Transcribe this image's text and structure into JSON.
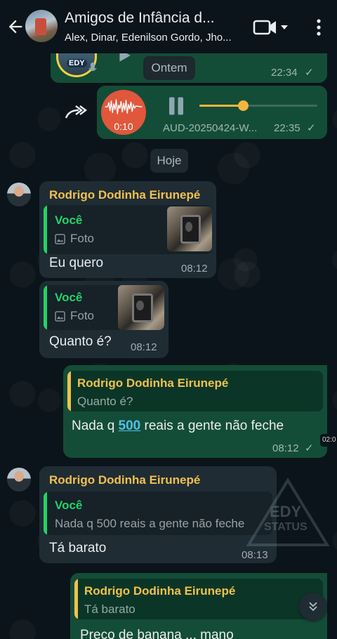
{
  "header": {
    "title": "Amigos de Infância d...",
    "participants": "Alex, Dinar, Edenilson Gordo, Jho..."
  },
  "top_audio": {
    "avatar_text": "EDY",
    "time": "22:34",
    "check": "✓"
  },
  "date_chips": {
    "yesterday": "Ontem",
    "today": "Hoje"
  },
  "audio_message": {
    "elapsed": "0:10",
    "file_name": "AUD-20250424-W...",
    "time": "22:35",
    "check": "✓",
    "progress": 0.37,
    "accent_color": "#f4b53f"
  },
  "messages": [
    {
      "sender": "Rodrigo Dodinha Eirunepé",
      "quote_name": "Você",
      "quote_text": "Foto",
      "text": "Eu quero",
      "time": "08:12"
    },
    {
      "quote_name": "Você",
      "quote_text": "Foto",
      "text": "Quanto é?",
      "time": "08:12"
    },
    {
      "quote_name": "Rodrigo Dodinha Eirunepé",
      "quote_text": "Quanto é?",
      "text_before": "Nada q ",
      "text_link": "500",
      "text_after": " reais a gente não feche",
      "time": "08:12",
      "check": "✓",
      "side_time": "02:0"
    },
    {
      "sender": "Rodrigo Dodinha Eirunepé",
      "quote_name": "Você",
      "quote_text": "Nada q 500 reais a gente não feche",
      "text": "Tá barato",
      "time": "08:13"
    },
    {
      "quote_name": "Rodrigo Dodinha Eirunepé",
      "quote_text": "Tá barato",
      "text": "Preço de banana ... mano"
    }
  ],
  "watermark": {
    "line1": "EDY",
    "line2": "STATUS"
  },
  "colors": {
    "sender_name": "#f2c14e",
    "you_name": "#25d366",
    "outgoing_bubble": "#144d37",
    "incoming_bubble": "#1f2c34",
    "link": "#53bdeb"
  },
  "icons": [
    "back-arrow-icon",
    "video-call-icon",
    "dropdown-arrow-icon",
    "more-options-icon",
    "forward-icon",
    "pause-icon",
    "photo-icon",
    "scroll-down-icon",
    "microphone-icon",
    "play-icon"
  ]
}
